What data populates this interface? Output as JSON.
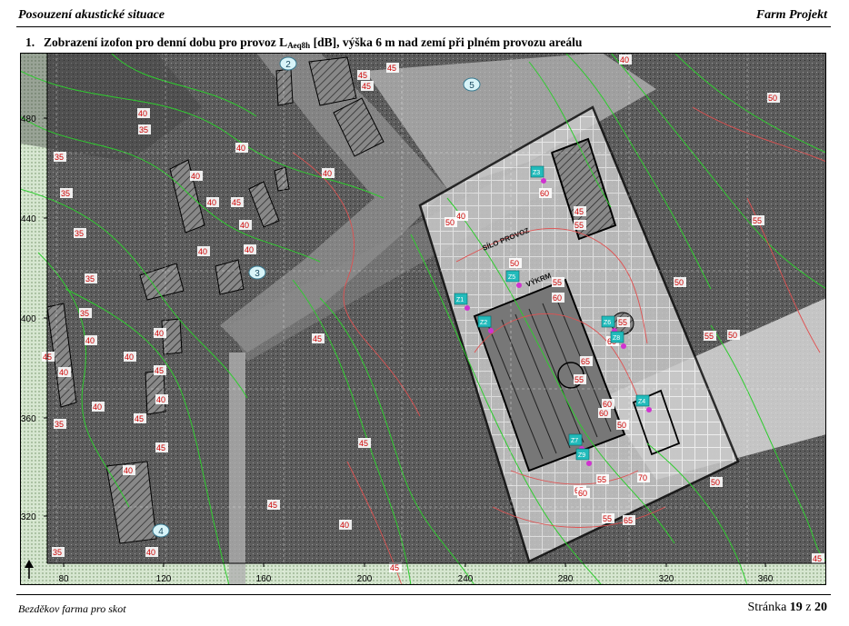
{
  "header": {
    "left_title": "Posouzení akustické situace",
    "right_title": "Farm Projekt"
  },
  "heading": {
    "number": "1.",
    "text_before": "Zobrazení izofon pro denní dobu pro provoz L",
    "subscript": "Aeq8h",
    "text_after": " [dB], výška 6 m nad zemí při plném provozu areálu"
  },
  "map": {
    "y_ticks": [
      "480",
      "440",
      "400",
      "360",
      "320"
    ],
    "x_ticks": [
      "80",
      "120",
      "160",
      "200",
      "240",
      "280",
      "320",
      "360"
    ],
    "markers": [
      "2",
      "5",
      "3",
      "4"
    ],
    "building_labels": [
      "SÍLO PROVOZ",
      "VÝKRM"
    ],
    "source_labels": [
      "Z3",
      "Z1",
      "Z5",
      "Z2",
      "Z6",
      "Z8",
      "Z4",
      "Z7",
      "Z9"
    ],
    "level_labels": [
      "45",
      "45",
      "45",
      "40",
      "35",
      "40",
      "35",
      "40",
      "40",
      "35",
      "45",
      "40",
      "40",
      "35",
      "40",
      "40",
      "35",
      "35",
      "40",
      "45",
      "45",
      "40",
      "40",
      "40",
      "45",
      "40",
      "45",
      "35",
      "40",
      "45",
      "40",
      "40",
      "35",
      "45",
      "40",
      "45",
      "40",
      "50",
      "60",
      "55",
      "50",
      "55",
      "60",
      "55",
      "60",
      "65",
      "55",
      "50",
      "55",
      "60",
      "50",
      "60",
      "55",
      "65",
      "70",
      "60",
      "55",
      "65",
      "50",
      "55",
      "50",
      "50",
      "45",
      "40",
      "45",
      "45"
    ],
    "colors": {
      "isoline_green": "#2ecc2e",
      "isoline_red": "#e05050",
      "level_text": "#cc0000",
      "marker_fill": "#d8f4f8",
      "source_fill": "#22bbbb"
    }
  },
  "footer": {
    "left": "Bezděkov farma pro skot",
    "page_label": "Stránka",
    "page_current": "19",
    "page_sep": "z",
    "page_total": "20"
  }
}
